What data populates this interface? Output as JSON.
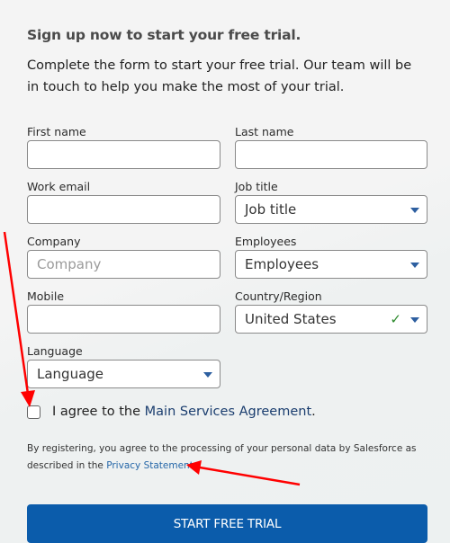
{
  "header": {
    "title": "Sign up now to start your free trial.",
    "intro": "Complete the form to start your free trial. Our team will be in touch to help you make the most of your trial."
  },
  "form": {
    "first_name": {
      "label": "First name",
      "value": "",
      "placeholder": ""
    },
    "last_name": {
      "label": "Last name",
      "value": "",
      "placeholder": ""
    },
    "work_email": {
      "label": "Work email",
      "value": "",
      "placeholder": ""
    },
    "job_title": {
      "label": "Job title",
      "selected": "Job title"
    },
    "company": {
      "label": "Company",
      "value": "",
      "placeholder": "Company"
    },
    "employees": {
      "label": "Employees",
      "selected": "Employees"
    },
    "mobile": {
      "label": "Mobile",
      "value": "",
      "placeholder": ""
    },
    "country": {
      "label": "Country/Region",
      "selected": "United States",
      "valid": true
    },
    "language": {
      "label": "Language",
      "selected": "Language"
    }
  },
  "agreement": {
    "checked": false,
    "prefix": "I agree to the ",
    "link_text": "Main Services Agreement",
    "suffix": "."
  },
  "legal": {
    "text": "By registering, you agree to the processing of your personal data by Salesforce as described in the ",
    "link_text": "Privacy Statement",
    "suffix": "."
  },
  "submit": {
    "label": "START FREE TRIAL"
  },
  "colors": {
    "primary_button": "#0b5cab",
    "link": "#1b3e6f",
    "caret": "#2d5fa0",
    "valid_check": "#2e8a2e",
    "annotation_arrow": "#ff0000"
  },
  "annotations": [
    {
      "name": "arrow-to-agreement-checkbox",
      "target": "agreement-checkbox"
    },
    {
      "name": "arrow-to-privacy-statement",
      "target": "privacy-statement-link"
    }
  ]
}
